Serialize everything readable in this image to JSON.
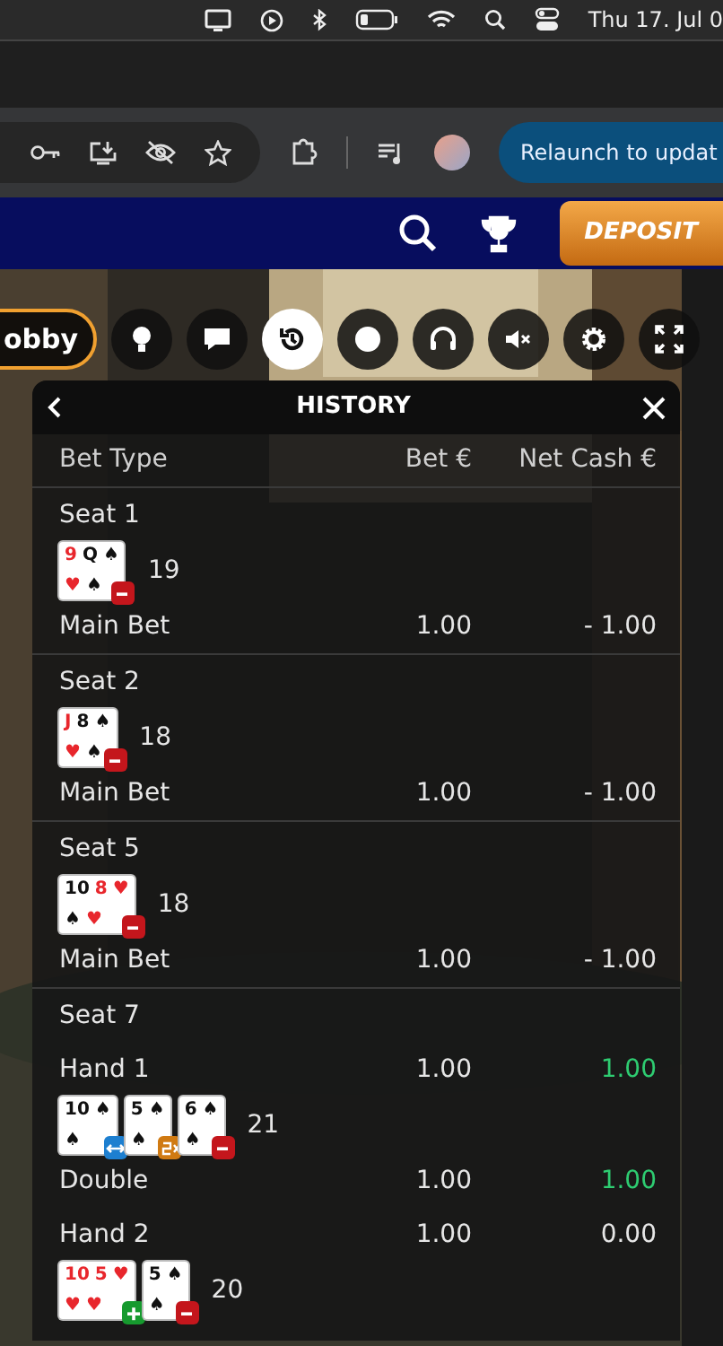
{
  "menu_bar": {
    "clock": "Thu 17. Jul 0"
  },
  "browser": {
    "relaunch": "Relaunch to updat"
  },
  "site_header": {
    "deposit": "DEPOSIT"
  },
  "game_toolbar": {
    "lobby": "obby",
    "buttons": [
      {
        "selected": false
      },
      {
        "selected": false
      },
      {
        "selected": true
      },
      {
        "selected": false
      },
      {
        "selected": false
      },
      {
        "selected": false
      },
      {
        "selected": false
      },
      {
        "selected": false
      }
    ]
  },
  "history": {
    "title": "HISTORY",
    "columns": [
      "Bet Type",
      "Bet €",
      "Net Cash €"
    ],
    "sections": [
      {
        "rows": [
          {
            "kind": "line",
            "label": "Seat 1"
          },
          {
            "kind": "cards",
            "total": "19",
            "groups": [
              {
                "kind": "minus",
                "top": [
                  {
                    "text": "9",
                    "red": true
                  },
                  {
                    "text": "Q",
                    "red": false
                  },
                  {
                    "text": "♠",
                    "red": false
                  }
                ],
                "bottom": [
                  {
                    "text": "♥",
                    "red": true
                  },
                  {
                    "text": "♠",
                    "red": false
                  }
                ]
              }
            ]
          },
          {
            "kind": "line",
            "label": "Main Bet",
            "bet": "1.00",
            "net": "- 1.00",
            "color": "#e6e6e6"
          }
        ]
      },
      {
        "rows": [
          {
            "kind": "line",
            "label": "Seat 2"
          },
          {
            "kind": "cards",
            "total": "18",
            "groups": [
              {
                "kind": "minus",
                "top": [
                  {
                    "text": "J",
                    "red": true
                  },
                  {
                    "text": "8",
                    "red": false
                  },
                  {
                    "text": "♠",
                    "red": false
                  }
                ],
                "bottom": [
                  {
                    "text": "♥",
                    "red": true
                  },
                  {
                    "text": "♠",
                    "red": false
                  }
                ]
              }
            ]
          },
          {
            "kind": "line",
            "label": "Main Bet",
            "bet": "1.00",
            "net": "- 1.00",
            "color": "#e6e6e6"
          }
        ]
      },
      {
        "rows": [
          {
            "kind": "line",
            "label": "Seat 5"
          },
          {
            "kind": "cards",
            "total": "18",
            "groups": [
              {
                "kind": "minus",
                "top": [
                  {
                    "text": "10",
                    "red": false
                  },
                  {
                    "text": "8",
                    "red": true
                  },
                  {
                    "text": "♥",
                    "red": true
                  }
                ],
                "bottom": [
                  {
                    "text": "♠",
                    "red": false
                  },
                  {
                    "text": "♥",
                    "red": true
                  }
                ]
              }
            ]
          },
          {
            "kind": "line",
            "label": "Main Bet",
            "bet": "1.00",
            "net": "- 1.00",
            "color": "#e6e6e6"
          }
        ]
      },
      {
        "rows": [
          {
            "kind": "line",
            "label": "Seat 7"
          },
          {
            "kind": "line",
            "label": "Hand 1",
            "bet": "1.00",
            "net": "1.00",
            "color": "#2ecc71"
          },
          {
            "kind": "cards",
            "total": "21",
            "groups": [
              {
                "kind": "split",
                "top": [
                  {
                    "text": "10",
                    "red": false
                  },
                  {
                    "text": "♠",
                    "red": false
                  }
                ],
                "bottom": [
                  {
                    "text": "♠",
                    "red": false
                  }
                ]
              },
              {
                "kind": "double",
                "top": [
                  {
                    "text": "5",
                    "red": false
                  },
                  {
                    "text": "♠",
                    "red": false
                  }
                ],
                "bottom": [
                  {
                    "text": "♠",
                    "red": false
                  }
                ]
              },
              {
                "kind": "minus",
                "top": [
                  {
                    "text": "6",
                    "red": false
                  },
                  {
                    "text": "♠",
                    "red": false
                  }
                ],
                "bottom": [
                  {
                    "text": "♠",
                    "red": false
                  }
                ]
              }
            ]
          },
          {
            "kind": "line",
            "label": "Double",
            "bet": "1.00",
            "net": "1.00",
            "color": "#2ecc71"
          },
          {
            "kind": "line",
            "label": "Hand 2",
            "bet": "1.00",
            "net": "0.00",
            "color": "#e6e6e6"
          },
          {
            "kind": "cards",
            "total": "20",
            "groups": [
              {
                "kind": "plus",
                "top": [
                  {
                    "text": "10",
                    "red": true
                  },
                  {
                    "text": "5",
                    "red": true
                  },
                  {
                    "text": "♥",
                    "red": true
                  }
                ],
                "bottom": [
                  {
                    "text": "♥",
                    "red": true
                  },
                  {
                    "text": "♥",
                    "red": true
                  }
                ]
              },
              {
                "kind": "minus",
                "top": [
                  {
                    "text": "5",
                    "red": false
                  },
                  {
                    "text": "♠",
                    "red": false
                  }
                ],
                "bottom": [
                  {
                    "text": "♠",
                    "red": false
                  }
                ]
              }
            ]
          }
        ]
      }
    ]
  }
}
